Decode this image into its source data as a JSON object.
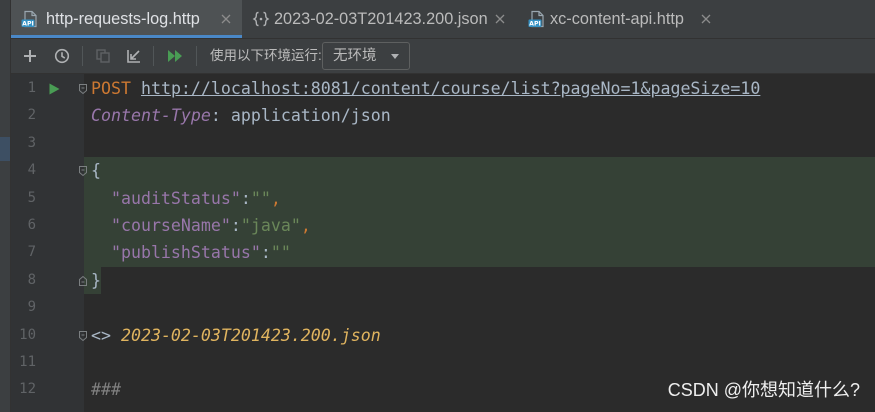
{
  "colors": {
    "chrome_bg": "#3c3f41",
    "editor_bg": "#2b2b2b",
    "gutter_bg": "#313335",
    "accent": "#4a88c7",
    "fragment_highlight": "#354136",
    "line_number": "#606366",
    "run_green": "#499c54"
  },
  "tabs": [
    {
      "label": "http-requests-log.http",
      "icon": "api-file-icon",
      "icon_badge": "API",
      "active": true
    },
    {
      "label": "2023-02-03T201423.200.json",
      "icon": "json-file-icon",
      "active": false
    },
    {
      "label": "xc-content-api.http",
      "icon": "api-file-icon",
      "icon_badge": "API",
      "active": false
    }
  ],
  "toolbar": {
    "actions": [
      {
        "icon": "add-icon"
      },
      {
        "icon": "history-icon"
      },
      {
        "icon": "copy-icon",
        "disabled": true
      },
      {
        "icon": "import-icon"
      },
      {
        "icon": "run-all-icon"
      }
    ],
    "env_label": "使用以下环境运行:",
    "env_select": "无环境",
    "env_select_icon": "chevron-down-icon"
  },
  "editor": {
    "lines": [
      {
        "number": "1",
        "run_icon": "run-gutter-icon",
        "fold_start": true,
        "tokens": [
          {
            "text": "POST",
            "color": "#cc7832"
          },
          {
            "text": " ",
            "color": "#a9b7c6"
          },
          {
            "text": "http://localhost:8081/content/course/list?pageNo=1&pageSize=10",
            "color": "#a9b7c6",
            "underline": true
          }
        ]
      },
      {
        "number": "2",
        "tokens": [
          {
            "text": "Content-Type",
            "color": "#9876aa",
            "italic": true
          },
          {
            "text": ": application/json",
            "color": "#a9b7c6"
          }
        ]
      },
      {
        "number": "3",
        "tokens": []
      },
      {
        "number": "4",
        "fold_start": true,
        "highlight": true,
        "tokens": [
          {
            "text": "{",
            "color": "#a9b7c6"
          }
        ]
      },
      {
        "number": "5",
        "highlight": true,
        "tokens": [
          {
            "text": "  ",
            "color": "#a9b7c6"
          },
          {
            "text": "\"auditStatus\"",
            "color": "#9876aa"
          },
          {
            "text": ":",
            "color": "#a9b7c6"
          },
          {
            "text": "\"\"",
            "color": "#6a8759"
          },
          {
            "text": ",",
            "color": "#cc7832"
          }
        ]
      },
      {
        "number": "6",
        "highlight": true,
        "tokens": [
          {
            "text": "  ",
            "color": "#a9b7c6"
          },
          {
            "text": "\"courseName\"",
            "color": "#9876aa"
          },
          {
            "text": ":",
            "color": "#a9b7c6"
          },
          {
            "text": "\"java\"",
            "color": "#6a8759"
          },
          {
            "text": ",",
            "color": "#cc7832"
          }
        ]
      },
      {
        "number": "7",
        "highlight": true,
        "tokens": [
          {
            "text": "  ",
            "color": "#a9b7c6"
          },
          {
            "text": "\"publishStatus\"",
            "color": "#9876aa"
          },
          {
            "text": ":",
            "color": "#a9b7c6"
          },
          {
            "text": "\"\"",
            "color": "#6a8759"
          }
        ]
      },
      {
        "number": "8",
        "fold_end": true,
        "highlight_to_text_end": true,
        "tokens": [
          {
            "text": "}",
            "color": "#a9b7c6"
          }
        ]
      },
      {
        "number": "9",
        "tokens": []
      },
      {
        "number": "10",
        "fold_start": true,
        "tokens": [
          {
            "text": "<> ",
            "color": "#a9b7c6"
          },
          {
            "text": "2023-02-03T201423.200.json",
            "color": "#e0b45f",
            "italic": true
          }
        ]
      },
      {
        "number": "11",
        "tokens": []
      },
      {
        "number": "12",
        "tokens": [
          {
            "text": "###",
            "color": "#808080"
          }
        ]
      }
    ]
  },
  "watermark": "CSDN @你想知道什么?"
}
